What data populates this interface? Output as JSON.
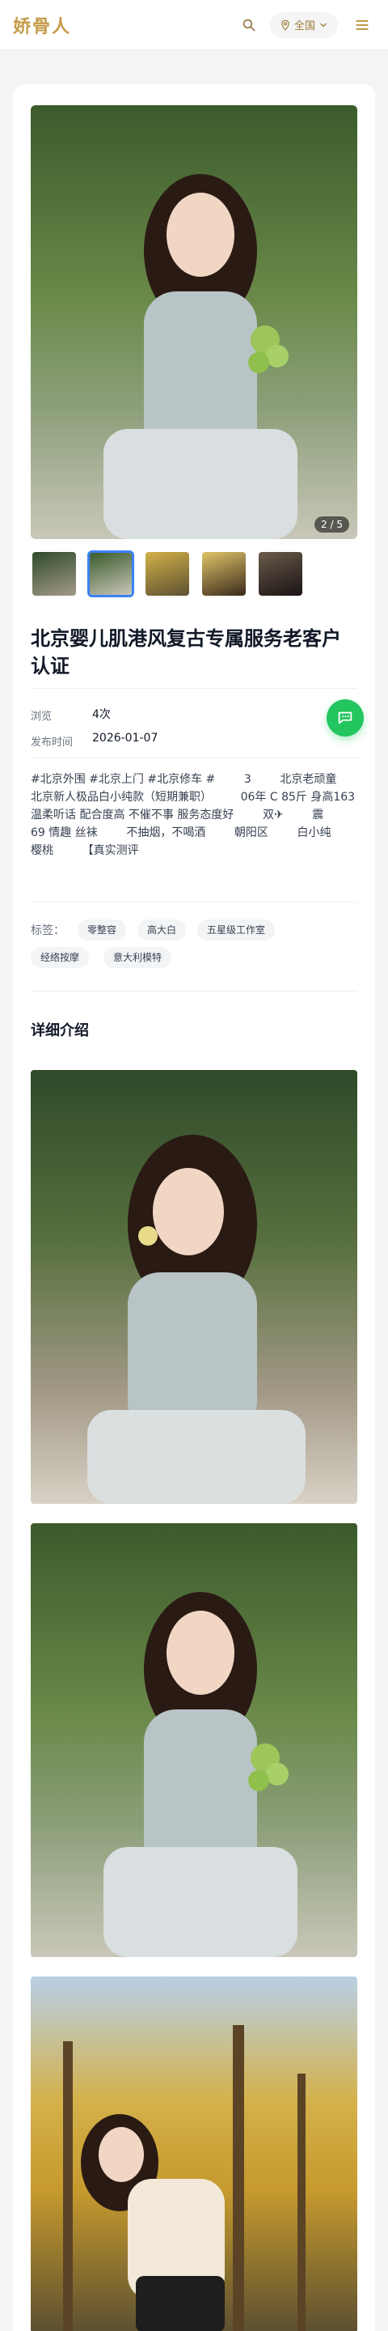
{
  "header": {
    "logo": "娇骨人",
    "region_label": "全国"
  },
  "gallery": {
    "pager": "2 / 5"
  },
  "post": {
    "title": "北京婴儿肌港风复古专属服务老客户认证",
    "meta": {
      "views_label": "浏览",
      "views_value": "4次",
      "date_label": "发布时间",
      "date_value": "2026-01-07"
    },
    "description": "#北京外围 #北京上门 #北京修车 #        3        北京老顽童        北京新人极品白小纯款（短期兼职）        06年 C 85斤 身高163        温柔听话 配合度高 不催不事 服务态度好        双✈        震        69 情趣 丝袜        不抽烟，不喝酒        朝阳区        白小纯        樱桃        【真实测评",
    "tags_label": "标签：",
    "tags": [
      "零整容",
      "高大白",
      "五星级工作室",
      "经络按摩",
      "意大利模特"
    ]
  },
  "details": {
    "section_title": "详细介绍"
  },
  "colors": {
    "brand_gold": "#c59a47",
    "accent_blue": "#3b82f6",
    "chat_green": "#22c55e"
  },
  "icons": {
    "search": "search-icon",
    "location": "location-pin-icon",
    "chevron": "chevron-down-icon",
    "menu": "hamburger-menu-icon",
    "chat": "chat-bubble-icon"
  }
}
